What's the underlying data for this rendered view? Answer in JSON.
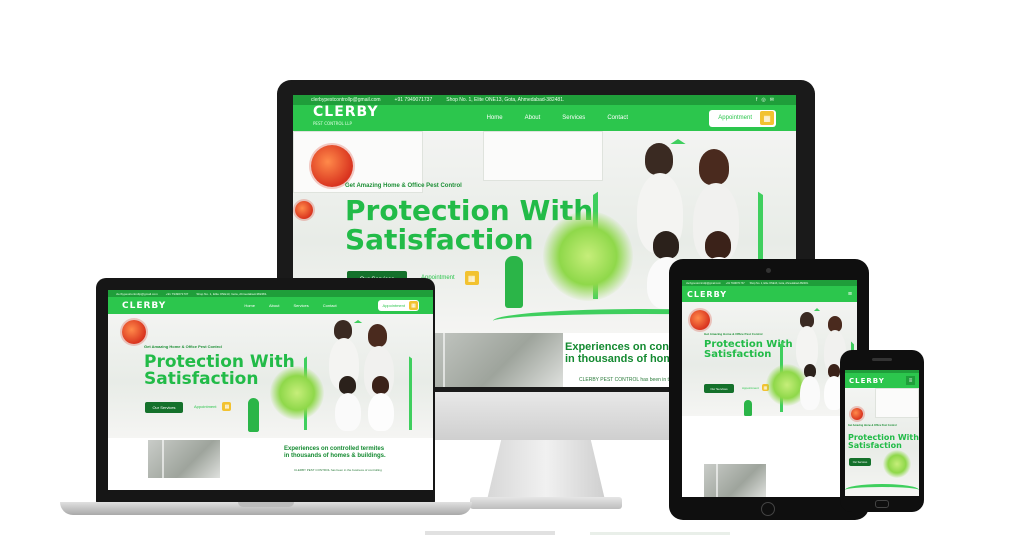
{
  "brand": {
    "name": "CLERBY",
    "tagline": "PEST CONTROL LLP",
    "primary_color": "#2cc64d",
    "dark_green": "#14712b",
    "accent_yellow": "#f2c230"
  },
  "topbar": {
    "email": "clerbypestcontrollp@gmail.com",
    "phone": "+91 7949071737",
    "address": "Shop No. 1, Elite ONE13, Gota, Ahmedabad-382481.",
    "social_icons": [
      "facebook-icon",
      "instagram-icon",
      "email-icon"
    ]
  },
  "nav": {
    "items": [
      "Home",
      "About",
      "Services",
      "Contact"
    ],
    "appointment": "Appointment"
  },
  "hero": {
    "eyebrow": "Get Amazing Home & Office Pest Control",
    "headline_line1": "Protection With",
    "headline_line2": "Satisfaction",
    "services_button": "Our Services",
    "appointment_button": "Appointment"
  },
  "experience": {
    "title_line1": "Experiences on controlled termites",
    "title_line2": "in thousands of homes & buildings.",
    "body": "CLERBY PEST CONTROL has been in the business of controlling",
    "monitor_title_line1": "Experiences on controlled",
    "monitor_title_line2": "in thousands of homes",
    "monitor_body": "CLERBY PEST CONTROL has been in th"
  }
}
